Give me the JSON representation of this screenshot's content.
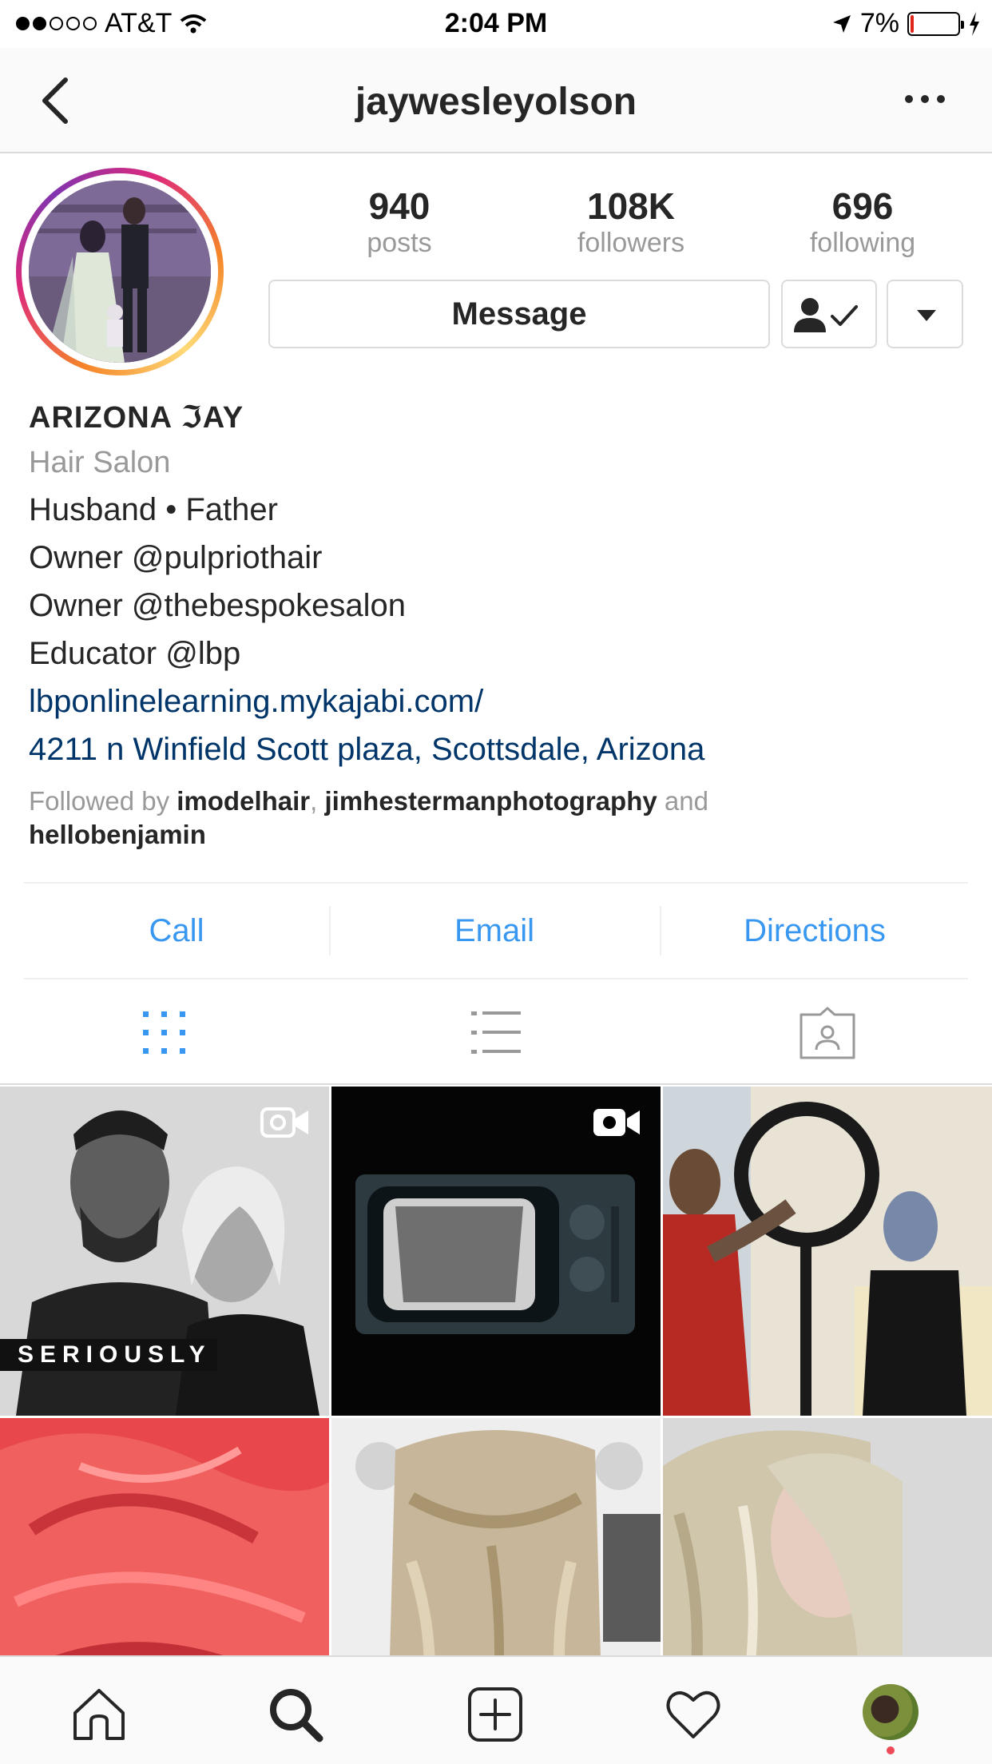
{
  "status_bar": {
    "carrier": "AT&T",
    "time": "2:04 PM",
    "battery_percent": "7%",
    "battery_level": 0.07,
    "signal_bars": 2
  },
  "nav": {
    "username": "jaywesleyolson"
  },
  "profile": {
    "stats": [
      {
        "value": "940",
        "label": "posts"
      },
      {
        "value": "108K",
        "label": "followers"
      },
      {
        "value": "696",
        "label": "following"
      }
    ],
    "message_label": "Message"
  },
  "bio": {
    "name": "ARIZONA ℑAY",
    "category": "Hair Salon",
    "lines": [
      "Husband • Father",
      "Owner @pulpriothair",
      "Owner @thebespokesalon",
      "Educator @lbp"
    ],
    "website": "lbponlinelearning.mykajabi.com/",
    "address": "4211 n Winfield Scott plaza, Scottsdale, Arizona",
    "followed_by_prefix": "Followed by",
    "followed_by": [
      "imodelhair",
      "jimhestermanphotography",
      "hellobenjamin"
    ],
    "followed_by_and": "and"
  },
  "contact": {
    "call": "Call",
    "email": "Email",
    "directions": "Directions"
  },
  "grid": {
    "overlay_text": "SERIOUSLY"
  },
  "colors": {
    "link": "#003569",
    "action_blue": "#3897f0",
    "muted": "#999999",
    "text": "#262626"
  },
  "icons": [
    "back-chevron-icon",
    "more-icon",
    "following-check-icon",
    "dropdown-arrow-icon",
    "grid-icon",
    "list-icon",
    "tagged-icon",
    "video-icon",
    "home-icon",
    "search-icon",
    "add-icon",
    "heart-icon"
  ]
}
